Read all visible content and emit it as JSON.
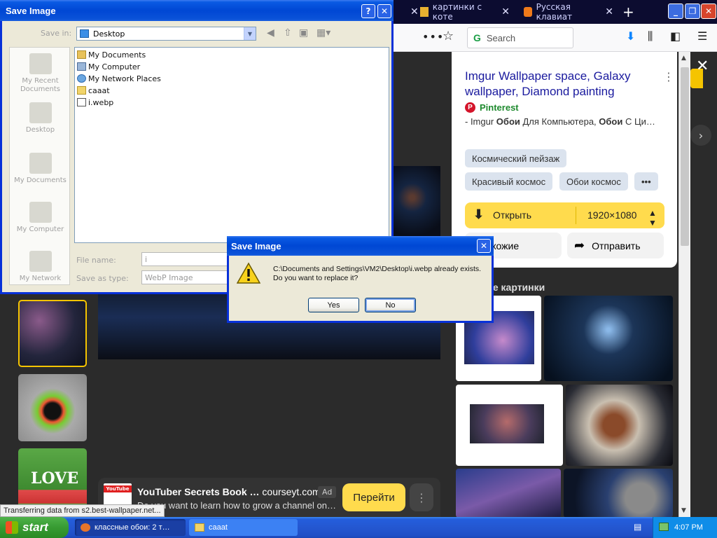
{
  "browser": {
    "tabs": [
      {
        "label": "картинки с коте",
        "close": "✕"
      },
      {
        "label": "Русская клавиат",
        "close": "✕"
      }
    ],
    "new_tab": "+",
    "search_placeholder": "Search",
    "more": "•••",
    "star": "☆"
  },
  "panel": {
    "title": "Imgur Wallpaper space, Galaxy wallpaper, Diamond painting",
    "source": "Pinterest",
    "snippet_prefix": "- Imgur ",
    "snippet_bold1": "Обои",
    "snippet_mid": " Для Компьютера, ",
    "snippet_bold2": "Обои",
    "snippet_suffix": " С Ци…",
    "chips": [
      "Космический пейзаж",
      "Красивый космос",
      "Обои космос",
      "•••"
    ],
    "open_label": "Открыть",
    "resolution": "1920×1080",
    "similar_label": "Похожие",
    "share_label": "Отправить",
    "similar_heading": "нные картинки"
  },
  "ad": {
    "logo_text": "YouTube",
    "title": "YouTuber Secrets Book …",
    "domain": "courseyt.com",
    "tag": "Ad",
    "desc": "Do you want to learn how to grow a channel on…",
    "go": "Перейти",
    "dots": "⋮",
    "love": "LOVE"
  },
  "status_text": "Transferring data from s2.best-wallpaper.net...",
  "save_dialog": {
    "title": "Save Image",
    "help": "?",
    "close": "✕",
    "save_in_label": "Save in:",
    "save_in_value": "Desktop",
    "places": [
      "My Recent Documents",
      "Desktop",
      "My Documents",
      "My Computer",
      "My Network"
    ],
    "files": [
      "My Documents",
      "My Computer",
      "My Network Places",
      "caaat",
      "i.webp"
    ],
    "file_name_label": "File name:",
    "file_name_value": "i",
    "save_as_type_label": "Save as type:",
    "save_as_type_value": "WebP Image"
  },
  "confirm": {
    "title": "Save Image",
    "close": "✕",
    "line1": "C:\\Documents and Settings\\VM2\\Desktop\\i.webp already exists.",
    "line2": "Do you want to replace it?",
    "yes": "Yes",
    "no": "No"
  },
  "taskbar": {
    "start": "start",
    "task1": "классные обои: 2 т…",
    "task2": "caaat",
    "clock": "4:07 PM"
  }
}
